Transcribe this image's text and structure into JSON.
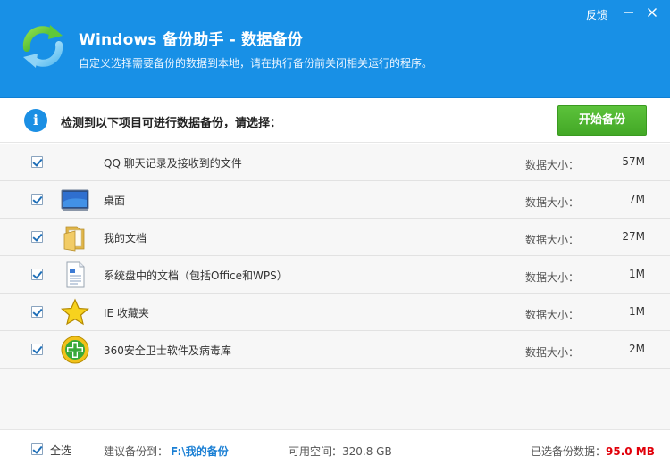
{
  "header": {
    "title": "Windows 备份助手 - 数据备份",
    "subtitle": "自定义选择需要备份的数据到本地，请在执行备份前关闭相关运行的程序。",
    "feedback": "反馈",
    "minimize_icon": "minimize-icon",
    "close_icon": "close-icon",
    "accent": "#1890e6"
  },
  "infobar": {
    "text": "检测到以下项目可进行数据备份，请选择：",
    "start_button": "开始备份",
    "button_color": "#4cb52e"
  },
  "items": [
    {
      "label": "QQ 聊天记录及接收到的文件",
      "size_label": "数据大小：",
      "size": "57M",
      "checked": true,
      "icon": "none"
    },
    {
      "label": "桌面",
      "size_label": "数据大小：",
      "size": "7M",
      "checked": true,
      "icon": "desktop-icon"
    },
    {
      "label": "我的文档",
      "size_label": "数据大小：",
      "size": "27M",
      "checked": true,
      "icon": "folder-icon"
    },
    {
      "label": "系统盘中的文档（包括Office和WPS）",
      "size_label": "数据大小：",
      "size": "1M",
      "checked": true,
      "icon": "document-icon"
    },
    {
      "label": "IE 收藏夹",
      "size_label": "数据大小：",
      "size": "1M",
      "checked": true,
      "icon": "star-icon"
    },
    {
      "label": "360安全卫士软件及病毒库",
      "size_label": "数据大小：",
      "size": "2M",
      "checked": true,
      "icon": "360-icon"
    }
  ],
  "footer": {
    "select_all": "全选",
    "suggest_label": "建议备份到：",
    "suggest_path": "F:\\我的备份",
    "space_label": "可用空间：",
    "space_value": "320.8 GB",
    "selected_label": "已选备份数据：",
    "selected_value": "95.0 MB"
  }
}
